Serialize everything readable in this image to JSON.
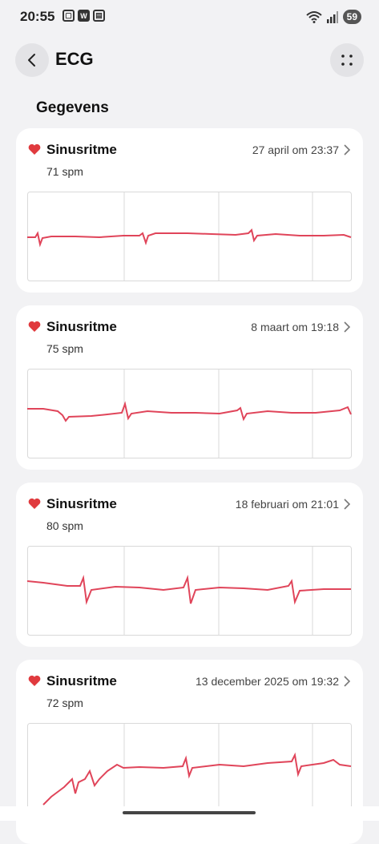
{
  "status": {
    "time": "20:55",
    "battery": "59"
  },
  "header": {
    "title": "ECG"
  },
  "section": {
    "title": "Gegevens"
  },
  "records": [
    {
      "rhythm": "Sinusritme",
      "date": "27 april om 23:37",
      "bpm": "71 spm"
    },
    {
      "rhythm": "Sinusritme",
      "date": "8 maart om 19:18",
      "bpm": "75 spm"
    },
    {
      "rhythm": "Sinusritme",
      "date": "18 februari om 21:01",
      "bpm": "80 spm"
    },
    {
      "rhythm": "Sinusritme",
      "date": "13 december 2025 om 19:32",
      "bpm": "72 spm"
    }
  ],
  "colors": {
    "ecg_line": "#e0455a",
    "heart": "#e03a3e",
    "grid": "#d9d9d9"
  }
}
